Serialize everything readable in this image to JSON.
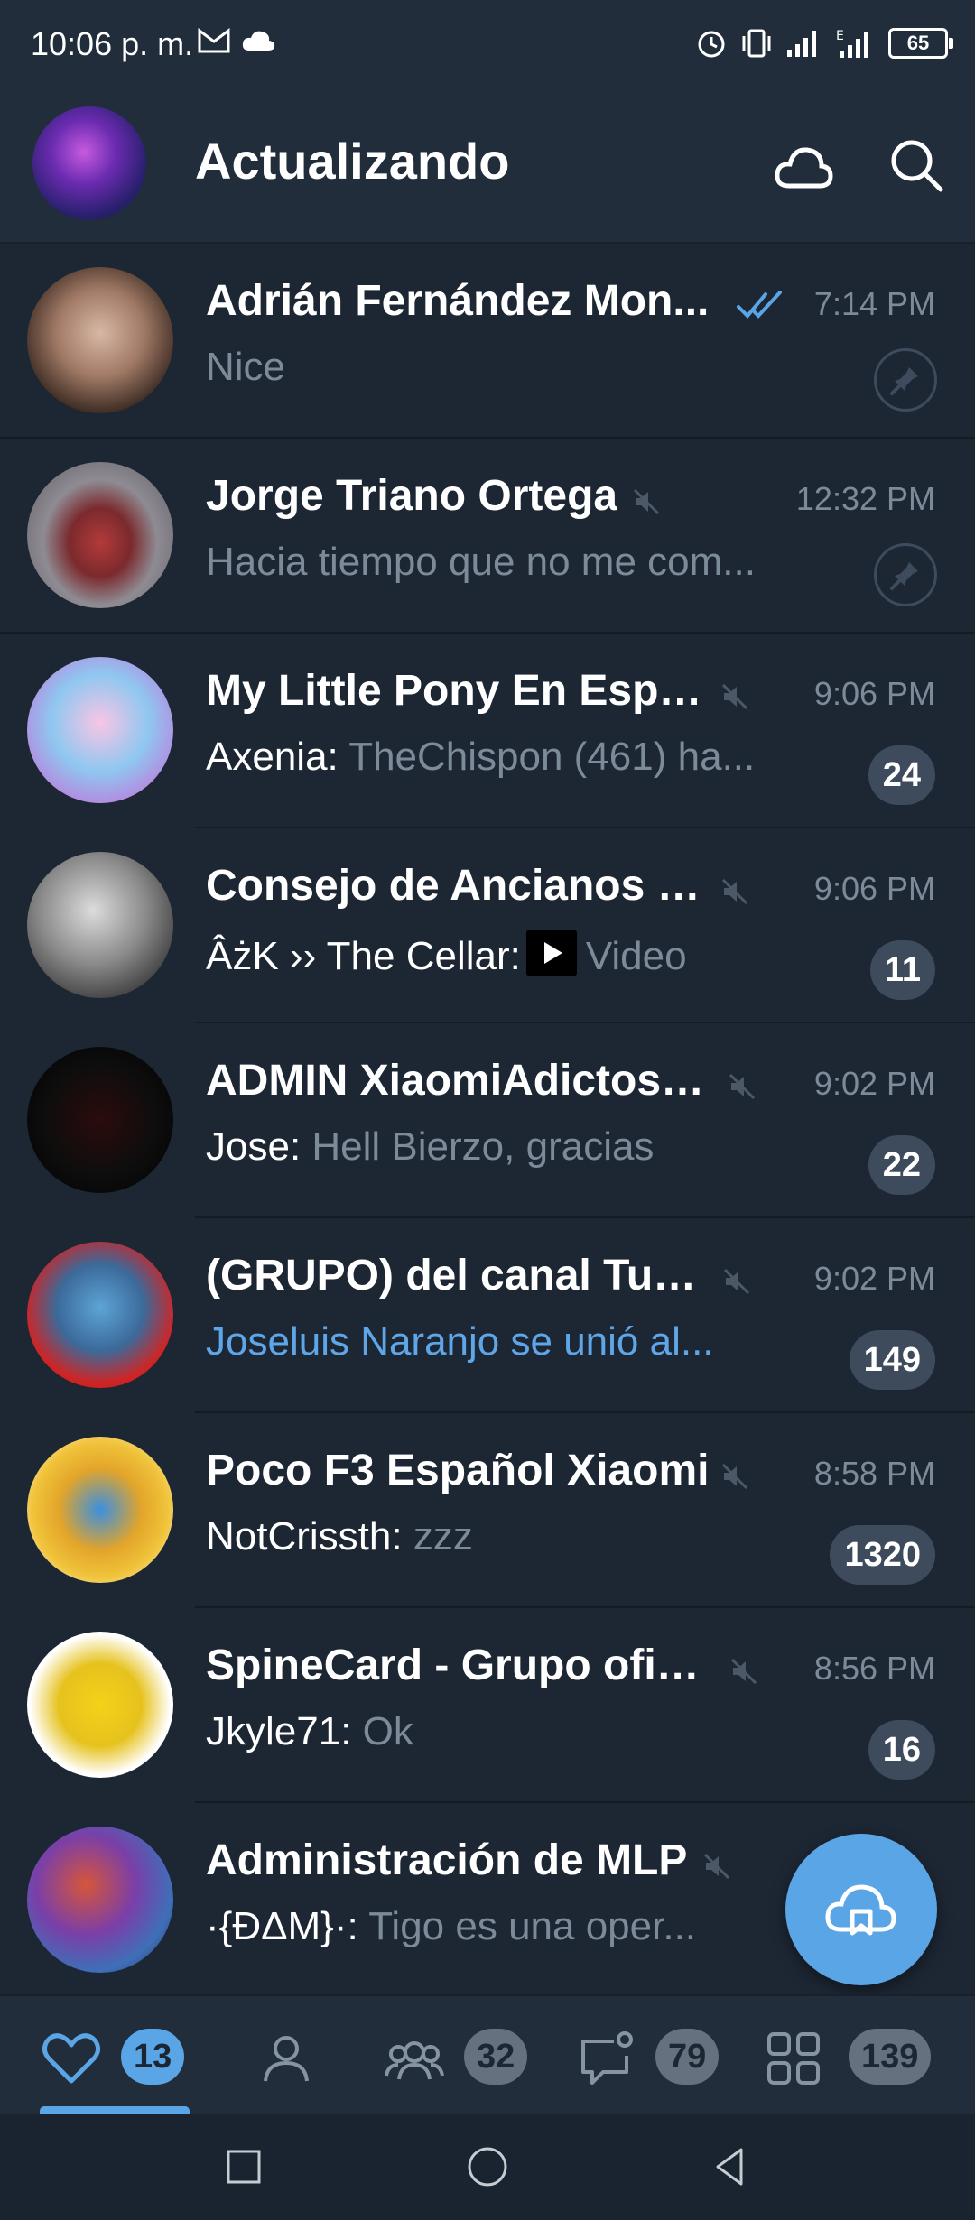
{
  "status_bar": {
    "time": "10:06 p. m.",
    "left_icons": [
      "gmail-icon",
      "cloud-icon"
    ],
    "right_icons": [
      "alarm-icon",
      "vibrate-icon",
      "signal-icon",
      "signal-e-icon"
    ],
    "battery": "65"
  },
  "app_bar": {
    "title": "Actualizando",
    "icons": [
      "cloud-icon",
      "search-icon"
    ]
  },
  "chats": [
    {
      "name": "Adrián Fernández Mon...",
      "time": "7:14 PM",
      "sender": "",
      "message": "Nice",
      "badge": "",
      "pinned": true,
      "muted": false,
      "read": true
    },
    {
      "name": "Jorge Triano Ortega",
      "time": "12:32 PM",
      "sender": "",
      "message": "Hacia tiempo que no me com...",
      "badge": "",
      "pinned": true,
      "muted": true
    },
    {
      "name": "My Little Pony En Espa...",
      "time": "9:06 PM",
      "sender": "Axenia:",
      "message": "TheChispon (461) ha...",
      "badge": "24",
      "muted": true
    },
    {
      "name": "Consejo de Ancianos c...",
      "time": "9:06 PM",
      "sender": "ÂżK ›› The Cellar:",
      "message": "Video",
      "badge": "11",
      "muted": true
    },
    {
      "name": "ADMIN XiaomiAdictos-...",
      "time": "9:02 PM",
      "sender": "Jose:",
      "message": "Hell Bierzo, gracias",
      "badge": "22",
      "muted": true
    },
    {
      "name": "(GRUPO) del canal Tub...",
      "time": "9:02 PM",
      "sender": "",
      "message": "Joseluis Naranjo se unió al...",
      "badge": "149",
      "muted": true
    },
    {
      "name": "Poco F3 Español Xiaomi",
      "time": "8:58 PM",
      "sender": "NotCrissth:",
      "message": "zzz",
      "badge": "1320",
      "muted": true
    },
    {
      "name": "SpineCard - Grupo ofici...",
      "time": "8:56 PM",
      "sender": "Jkyle71:",
      "message": "Ok",
      "badge": "16",
      "muted": true
    },
    {
      "name": "Administración de MLP",
      "time": "",
      "sender": "·{ÐΔM}·:",
      "message": "Tigo es una oper...",
      "badge": "",
      "muted": true
    }
  ],
  "tabs": [
    {
      "icon": "heart-icon",
      "badge": "13",
      "active": true
    },
    {
      "icon": "person-icon",
      "badge": ""
    },
    {
      "icon": "group-icon",
      "badge": "32"
    },
    {
      "icon": "chat-bubble-icon",
      "badge": "79"
    },
    {
      "icon": "grid-icon",
      "badge": "139"
    }
  ],
  "colors": {
    "background": "#1d2734",
    "bar": "#212d3b",
    "accent": "#5aa5e6",
    "secondary_text": "#7d8b99",
    "badge": "#3d4b5c"
  }
}
